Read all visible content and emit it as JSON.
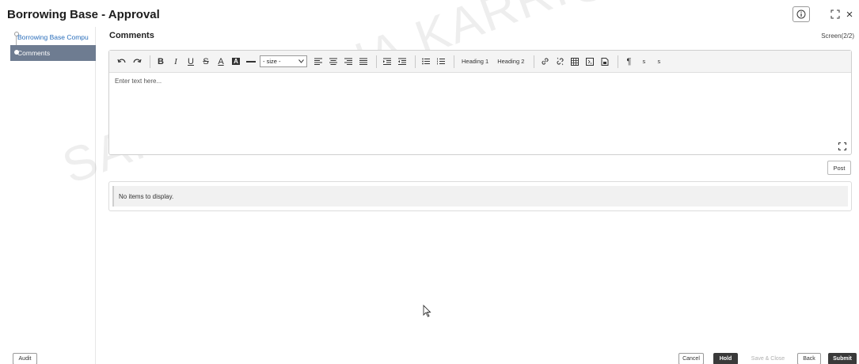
{
  "header": {
    "title": "Borrowing Base - Approval",
    "info_icon": "info-icon",
    "expand_icon": "expand-icon",
    "close_glyph": "×"
  },
  "sidebar": {
    "items": [
      {
        "label": "Borrowing Base Compu",
        "active": false
      },
      {
        "label": "Comments",
        "active": true
      }
    ]
  },
  "main": {
    "section_title": "Comments",
    "screen_indicator": "Screen(2/2)",
    "editor": {
      "placeholder": "Enter text here...",
      "toolbar": {
        "bold": "B",
        "italic": "I",
        "underline": "U",
        "strike": "S",
        "font_color": "A",
        "bg_color": "A",
        "size_select": "- size -",
        "heading1": "Heading 1",
        "heading2": "Heading 2",
        "paragraph": "¶",
        "subscript": "s",
        "superscript": "s"
      }
    },
    "post_label": "Post",
    "empty_message": "No items to display."
  },
  "watermark": "SAI.SIREESHA.KARRI@ORACLE.COM",
  "footer": {
    "audit": "Audit",
    "cancel": "Cancel",
    "hold": "Hold",
    "save_close": "Save & Close",
    "back": "Back",
    "submit": "Submit"
  },
  "colors": {
    "active_sidebar": "#6e7c91",
    "link": "#2a6ebb",
    "primary_button": "#3a3a3a"
  }
}
